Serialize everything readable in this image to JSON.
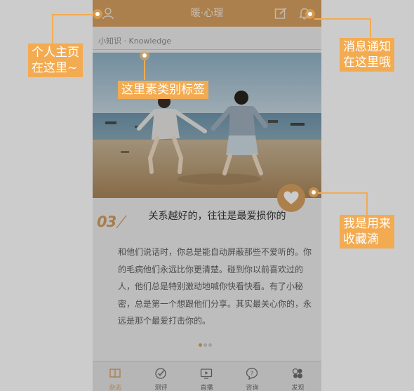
{
  "app": {
    "title": "暖·心理",
    "icons": {
      "profile": "user-icon",
      "compose": "compose-icon",
      "notifications": "bell-icon"
    }
  },
  "category": {
    "label": "小知识 · Knowledge"
  },
  "article": {
    "number": "03",
    "title": "关系越好的，往往是最爱损你的",
    "body": "和他们说话时，你总是能自动屏蔽那些不爱听的。你的毛病他们永远比你更清楚。碰到你以前喜欢过的人，他们总是特别激动地喊你快看快看。有了小秘密，总是第一个想跟他们分享。其实最关心你的，永远是那个最爱打击你的。",
    "photo_icon": "beach-couple-photo",
    "favorite_icon": "heart-icon"
  },
  "pagination": {
    "total": 3,
    "active": 1
  },
  "tabbar": {
    "items": [
      {
        "label": "杂志",
        "icon": "book-icon",
        "active": true
      },
      {
        "label": "测评",
        "icon": "test-icon",
        "active": false
      },
      {
        "label": "直播",
        "icon": "live-icon",
        "active": false
      },
      {
        "label": "咨询",
        "icon": "question-icon",
        "active": false
      },
      {
        "label": "发现",
        "icon": "discover-icon",
        "active": false
      }
    ]
  },
  "annotations": {
    "profile": "个人主页\n在这里~",
    "category_tag": "这里素类别标签",
    "notifications": "消息通知\n在这里哦",
    "favorite": "我是用来\n收藏滴"
  },
  "colors": {
    "accent": "#f3ab51",
    "header": "#d7a15f",
    "overlay": "rgba(0,0,0,0.20)"
  }
}
